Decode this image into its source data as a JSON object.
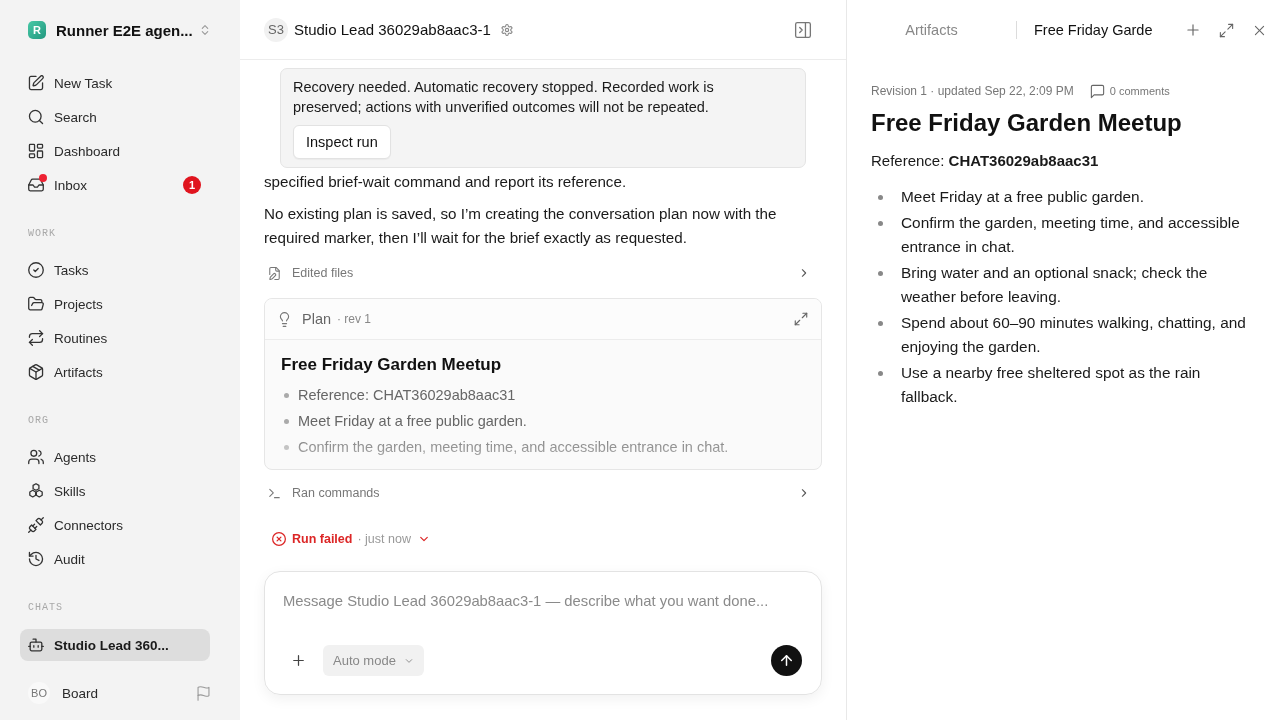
{
  "sidebar": {
    "workspace": {
      "initial": "R",
      "name": "Runner E2E agen..."
    },
    "groups": [
      {
        "items": [
          {
            "label": "New Task",
            "selected": false,
            "unread": false
          },
          {
            "label": "Search",
            "selected": false,
            "unread": false
          },
          {
            "label": "Dashboard",
            "selected": false,
            "unread": false
          },
          {
            "label": "Inbox",
            "selected": false,
            "unread": true,
            "badge": "1"
          }
        ]
      },
      {
        "heading": "WORK",
        "items": [
          {
            "label": "Tasks",
            "selected": false,
            "unread": false
          },
          {
            "label": "Projects",
            "selected": false,
            "unread": false
          },
          {
            "label": "Routines",
            "selected": false,
            "unread": false
          },
          {
            "label": "Artifacts",
            "selected": false,
            "unread": false
          }
        ]
      },
      {
        "heading": "ORG",
        "items": [
          {
            "label": "Agents",
            "selected": false,
            "unread": false
          },
          {
            "label": "Skills",
            "selected": false,
            "unread": false
          },
          {
            "label": "Connectors",
            "selected": false,
            "unread": false
          },
          {
            "label": "Audit",
            "selected": false,
            "unread": false
          }
        ]
      },
      {
        "heading": "CHATS",
        "items": [
          {
            "label": "Studio Lead 360...",
            "selected": true,
            "unread": false
          }
        ]
      }
    ],
    "footer": {
      "avatar": "BO",
      "name": "Board"
    }
  },
  "chat": {
    "header": {
      "avatar": "S3",
      "title": "Studio Lead 36029ab8aac3-1"
    },
    "recovery_banner": {
      "text": "Recovery needed. Automatic recovery stopped. Recorded work is preserved; actions with unverified outcomes will not be repeated.",
      "button": "Inspect run"
    },
    "messages": [
      "specified brief-wait command and report its reference.",
      "No existing plan is saved, so I’m creating the conversation plan now with the required marker, then I’ll wait for the brief exactly as requested."
    ],
    "edited_files": {
      "label": "Edited files"
    },
    "plan": {
      "label": "Plan",
      "revision": "· rev 1",
      "title": "Free Friday Garden Meetup",
      "items": [
        "Reference: CHAT36029ab8aac31",
        "Meet Friday at a free public garden.",
        "Confirm the garden, meeting time, and accessible entrance in chat."
      ]
    },
    "ran_commands": {
      "label": "Ran commands"
    },
    "run_status": {
      "failed": true,
      "label": "Run failed",
      "time": "· just now"
    },
    "composer": {
      "placeholder": "Message Studio Lead 36029ab8aac3-1 — describe what you want done...",
      "mode": "Auto mode"
    }
  },
  "artifact_panel": {
    "tabs": [
      {
        "label": "Artifacts",
        "selected": false
      },
      {
        "label": "Free Friday Garde",
        "selected": true
      }
    ],
    "meta": "Revision 1 · updated Sep 22, 2:09 PM",
    "comments": "0 comments",
    "title": "Free Friday Garden Meetup",
    "reference": "Reference: **CHAT36029ab8aac31**",
    "items": [
      "Meet Friday at a free public garden.",
      "Confirm the garden, meeting time, and accessible entrance in chat.",
      "Bring water and an optional snack; check the weather before leaving.",
      "Spend about 60–90 minutes walking, chatting, and enjoying the garden.",
      "Use a nearby free sheltered spot as the rain fallback."
    ]
  }
}
